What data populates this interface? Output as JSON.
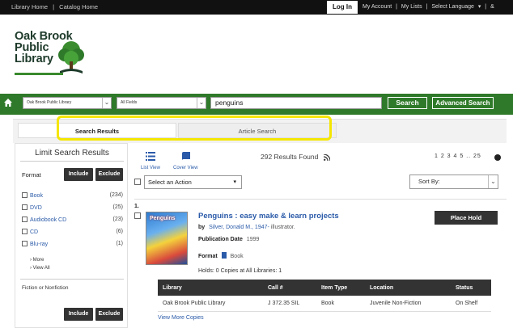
{
  "topbar": {
    "library_home": "Library Home",
    "separator": "|",
    "catalog_home": "Catalog Home",
    "login": "Log In",
    "my_account": "My Account",
    "my_lists": "My Lists",
    "select_language": "Select Language",
    "language_caret": "▾",
    "extra": "&"
  },
  "logo": {
    "line1": "Oak Brook",
    "line2": "Public",
    "line3": "Library"
  },
  "search": {
    "library_select": "Oak Brook Public Library",
    "field_select": "All Fields",
    "query": "penguins",
    "search_button": "Search",
    "advanced_search": "Advanced Search",
    "chevron": "⌄"
  },
  "tabs": {
    "search_results": "Search Results",
    "article_search": "Article Search"
  },
  "facets": {
    "title": "Limit Search Results",
    "format_label": "Format",
    "include": "Include",
    "exclude": "Exclude",
    "items": [
      {
        "label": "Book",
        "count": "(234)"
      },
      {
        "label": "DVD",
        "count": "(25)"
      },
      {
        "label": "Audiobook CD",
        "count": "(23)"
      },
      {
        "label": "CD",
        "count": "(6)"
      },
      {
        "label": "Blu-ray",
        "count": "(1)"
      }
    ],
    "more": "› More",
    "view_all": "› View All",
    "fiction_label": "Fiction or Nonfiction"
  },
  "results": {
    "list_view": "List View",
    "cover_view": "Cover View",
    "found": "292 Results Found",
    "pages": "1 2 3 4 5 .. 25",
    "action_select": "Select an Action",
    "sort_by": "Sort By:",
    "caret": "▾",
    "chevron": "⌄"
  },
  "record": {
    "number": "1.",
    "cover_text": "Penguins",
    "title": "Penguins : easy make & learn projects",
    "by_label": "by",
    "author": "Silver, Donald M., 1947-",
    "author_role": "illustrator.",
    "pubdate_label": "Publication Date",
    "pubdate": "1999",
    "format_label": "Format",
    "format": "Book",
    "holds": "Holds: 0   Copies at All Libraries: 1",
    "place_hold": "Place Hold",
    "view_more": "View More Copies"
  },
  "holdings": {
    "headers": [
      "Library",
      "Call #",
      "Item Type",
      "Location",
      "Status"
    ],
    "row": [
      "Oak Brook Public Library",
      "J 372.35 SIL",
      "Book",
      "Juvenile Non-Fiction",
      "On Shelf"
    ]
  },
  "colors": {
    "green": "#2f7a2a",
    "dark": "#333333",
    "link": "#2a5aa8",
    "highlight": "#f5e600"
  }
}
